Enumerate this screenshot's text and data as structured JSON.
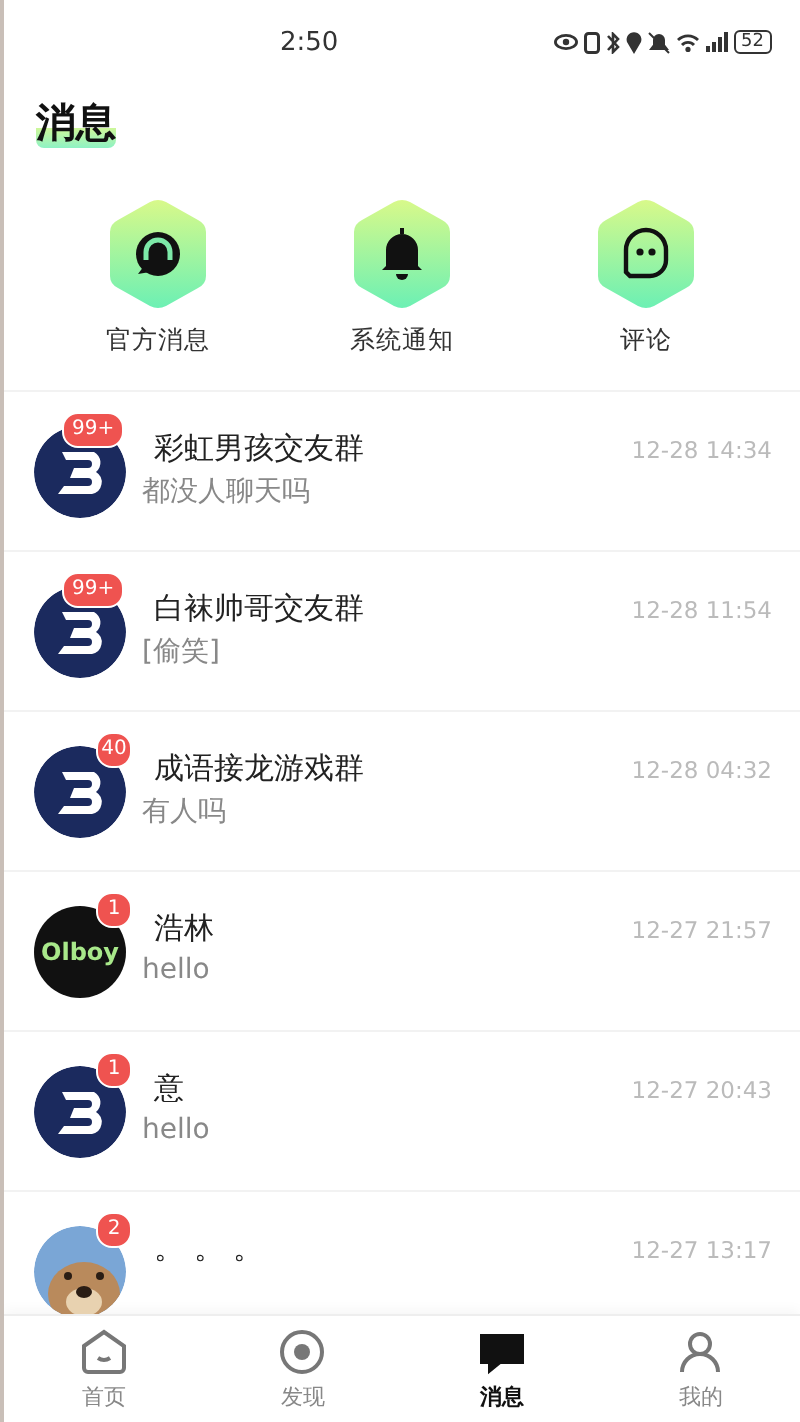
{
  "status_bar": {
    "time": "2:50",
    "battery": "52"
  },
  "title": "消息",
  "shortcuts": [
    {
      "kind": "headset",
      "label": "官方消息"
    },
    {
      "kind": "bell",
      "label": "系统通知"
    },
    {
      "kind": "ghost",
      "label": "评论"
    }
  ],
  "conversations": [
    {
      "avatar": {
        "kind": "logo"
      },
      "badge": "99+",
      "name": "彩虹男孩交友群",
      "preview": "都没人聊天吗",
      "time": "12-28 14:34"
    },
    {
      "avatar": {
        "kind": "logo"
      },
      "badge": "99+",
      "name": "白袜帅哥交友群",
      "preview": "[偷笑]",
      "time": "12-28 11:54"
    },
    {
      "avatar": {
        "kind": "logo"
      },
      "badge": "40",
      "name": "成语接龙游戏群",
      "preview": "有人吗",
      "time": "12-28 04:32"
    },
    {
      "avatar": {
        "kind": "text",
        "text": "Olboy"
      },
      "badge": "1",
      "name": "浩林",
      "preview": "hello",
      "time": "12-27 21:57"
    },
    {
      "avatar": {
        "kind": "logo"
      },
      "badge": "1",
      "name": "意",
      "preview": "hello",
      "time": "12-27 20:43"
    },
    {
      "badge": "2",
      "name": "。 。 。",
      "time": "12-27 13:17"
    }
  ],
  "tab_bar": [
    {
      "kind": "home",
      "label": "首页",
      "selected": false
    },
    {
      "kind": "discover",
      "label": "发现",
      "selected": false
    },
    {
      "kind": "message",
      "label": "消息",
      "selected": true
    },
    {
      "kind": "me",
      "label": "我的",
      "selected": false
    }
  ]
}
